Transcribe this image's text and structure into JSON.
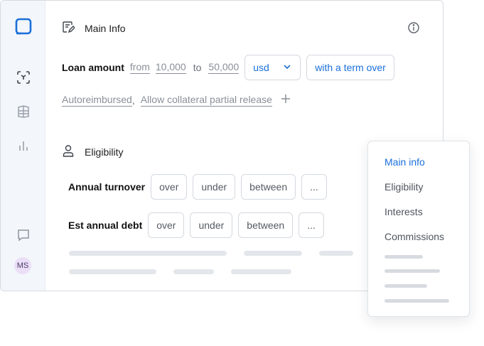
{
  "user": {
    "initials": "MS"
  },
  "main_info": {
    "title": "Main Info",
    "loan": {
      "label": "Loan amount",
      "from_label": "from",
      "from_value": "10,000",
      "to_label": "to",
      "to_value": "50,000",
      "currency": "usd",
      "term_button": "with a term over"
    },
    "options": [
      "Autoreimbursed",
      "Allow collateral partial release"
    ],
    "option_separator": ","
  },
  "eligibility": {
    "title": "Eligibility",
    "rows": [
      {
        "label": "Annual turnover",
        "buttons": [
          "over",
          "under",
          "between",
          "..."
        ]
      },
      {
        "label": "Est annual debt",
        "buttons": [
          "over",
          "under",
          "between",
          "..."
        ]
      }
    ]
  },
  "nav_menu": {
    "items": [
      "Main info",
      "Eligibility",
      "Interests",
      "Commissions"
    ],
    "active": "Main info"
  },
  "colors": {
    "accent": "#1a6fd9",
    "rail": "#f3f6fa",
    "avatar_bg": "#eadff7"
  },
  "icons": [
    "app-logo-icon",
    "target-icon",
    "grid-icon",
    "bar-chart-icon",
    "chat-icon",
    "edit-note-icon",
    "info-icon",
    "user-icon",
    "chevron-down-icon",
    "plus-icon"
  ]
}
